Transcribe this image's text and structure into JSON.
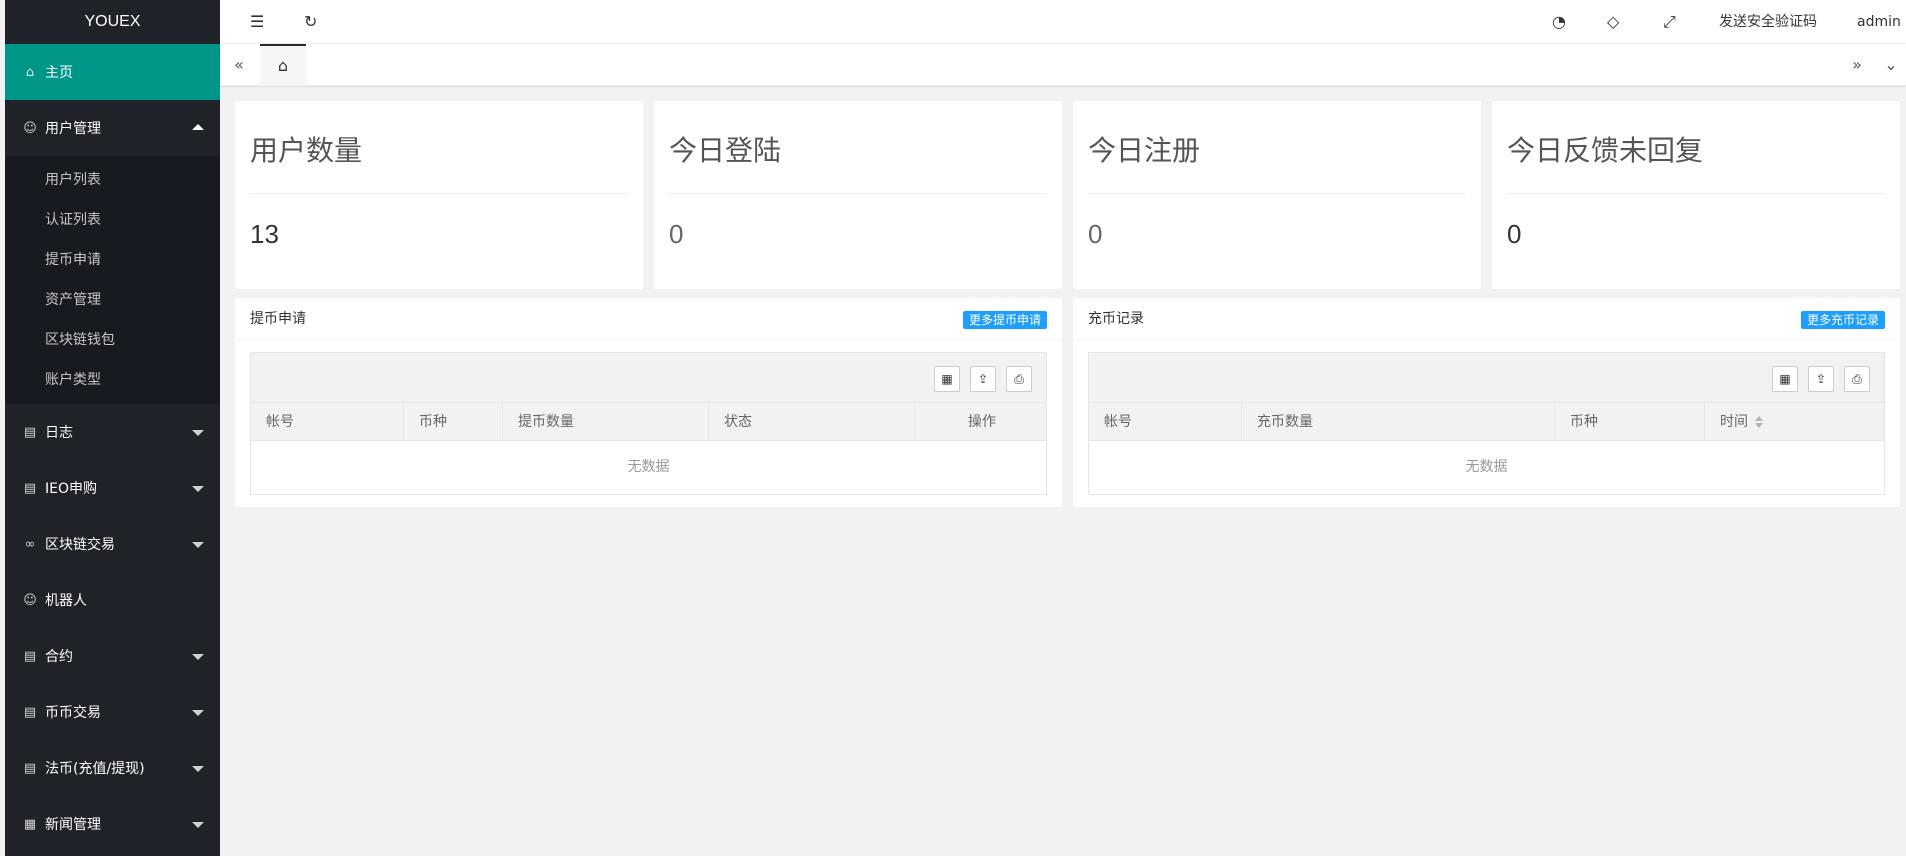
{
  "app": {
    "logo": "YOUEX"
  },
  "sidebar": {
    "home": {
      "label": "主页",
      "icon": "home-icon"
    },
    "user_mgmt": {
      "label": "用户管理",
      "icon": "user-icon",
      "children": [
        "用户列表",
        "认证列表",
        "提币申请",
        "资产管理",
        "区块链钱包",
        "账户类型"
      ]
    },
    "items": [
      {
        "label": "日志",
        "icon": "doc-icon",
        "expandable": true
      },
      {
        "label": "IEO申购",
        "icon": "doc-icon",
        "expandable": true
      },
      {
        "label": "区块链交易",
        "icon": "link-icon",
        "expandable": true
      },
      {
        "label": "机器人",
        "icon": "user-icon",
        "expandable": false
      },
      {
        "label": "合约",
        "icon": "doc-icon",
        "expandable": true
      },
      {
        "label": "币币交易",
        "icon": "doc-icon",
        "expandable": true
      },
      {
        "label": "法币(充值/提现)",
        "icon": "doc-icon",
        "expandable": true
      },
      {
        "label": "新闻管理",
        "icon": "news-icon",
        "expandable": true
      }
    ]
  },
  "header": {
    "send_code": "发送安全验证码",
    "user": "admin"
  },
  "stats": [
    {
      "title": "用户数量",
      "value": "13"
    },
    {
      "title": "今日登陆",
      "value": "0"
    },
    {
      "title": "今日注册",
      "value": "0"
    },
    {
      "title": "今日反馈未回复",
      "value": "0"
    }
  ],
  "withdraw_panel": {
    "title": "提币申请",
    "more": "更多提币申请",
    "columns": [
      "帐号",
      "币种",
      "提币数量",
      "状态",
      "操作"
    ],
    "empty": "无数据"
  },
  "deposit_panel": {
    "title": "充币记录",
    "more": "更多充币记录",
    "columns": [
      "帐号",
      "充币数量",
      "币种",
      "时间"
    ],
    "empty": "无数据"
  },
  "colors": {
    "accent": "#009688",
    "sidebar": "#20222a",
    "badge": "#1e9fff"
  }
}
